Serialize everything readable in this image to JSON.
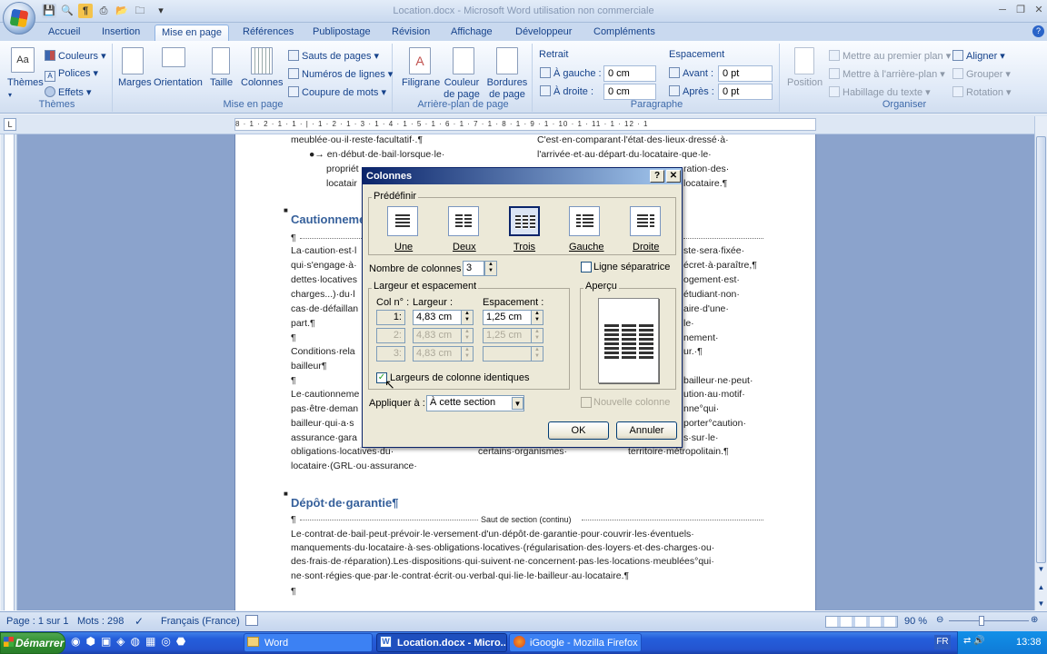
{
  "window": {
    "title": "Location.docx - Microsoft Word utilisation non commerciale"
  },
  "tabs": [
    "Accueil",
    "Insertion",
    "Mise en page",
    "Références",
    "Publipostage",
    "Révision",
    "Affichage",
    "Développeur",
    "Compléments"
  ],
  "active_tab": "Mise en page",
  "ribbon": {
    "themes": {
      "themes_label": "Thèmes",
      "colors": "Couleurs",
      "fonts": "Polices",
      "effects": "Effets",
      "group_label": "Thèmes"
    },
    "page_setup": {
      "margins": "Marges",
      "orientation": "Orientation",
      "size": "Taille",
      "columns": "Colonnes",
      "breaks": "Sauts de pages",
      "line_numbers": "Numéros de lignes",
      "hyphenation": "Coupure de mots",
      "group_label": "Mise en page"
    },
    "page_bg": {
      "watermark": "Filigrane",
      "page_color": "Couleur de page",
      "page_borders": "Bordures de page",
      "group_label": "Arrière-plan de page"
    },
    "paragraph": {
      "indent_label": "Retrait",
      "left_label": "À gauche :",
      "left_value": "0 cm",
      "right_label": "À droite :",
      "right_value": "0 cm",
      "spacing_label": "Espacement",
      "before_label": "Avant :",
      "before_value": "0 pt",
      "after_label": "Après :",
      "after_value": "0 pt",
      "group_label": "Paragraphe"
    },
    "arrange": {
      "position": "Position",
      "bring_front": "Mettre au premier plan",
      "send_back": "Mettre à l'arrière-plan",
      "wrap": "Habillage du texte",
      "align": "Aligner",
      "group": "Grouper",
      "rotate": "Rotation",
      "group_label": "Organiser"
    }
  },
  "ruler": {
    "text": "8 · 1 · 2 · 1 · 1 · | · 1 · 2 · 1 · 3 · 1 · 4 · 1 · 5 · 1 · 6 · 1 · 7 · 1 · 8 · 1 · 9 · 1 · 10 · 1 · 11 · 1 · 12 · 1"
  },
  "document": {
    "lines": [
      "meublée·ou·il·reste·facultatif·.¶",
      "●→ en·début·de·bail·lorsque·le·",
      "propriét",
      "locatair",
      "C'est·en·comparant·l'état·des·lieux·dressé·à·",
      "l'arrivée·et·au·départ·du·locataire·que·le·",
      "ration·des·",
      "locataire.¶",
      "La·caution·est·l",
      "qui·s'engage·à·",
      "dettes·locatives",
      "charges...)·du·l",
      "cas·de·défaillan",
      "part.¶",
      "¶",
      "Conditions·rela",
      "bailleur¶",
      "¶",
      "Le·cautionneme",
      "pas·être·deman",
      "bailleur·qui·a·s",
      "assurance·gara",
      "obligations·locatives·du·",
      "locataire·(GRL·ou·assurance·",
      "certains·organismes·",
      "territoire·métropolitain.¶",
      "Le·contrat·de·bail·peut·prévoir·le·versement·d'un·dépôt·de·garantie·pour·couvrir·les·éventuels·",
      "manquements·du·locataire·à·ses·obligations·locatives·(régularisation·des·loyers·et·des·charges·ou·",
      "des·frais·de·réparation).Les·dispositions·qui·suivent·ne·concernent·pas·les·locations·meublées°qui·",
      "ne·sont·régies·que·par·le·contrat·écrit·ou·verbal·qui·lie·le·bailleur·au·locataire.¶",
      "¶",
      "¶"
    ],
    "right_fragments": [
      "ste·sera·fixée·",
      "écret·à·paraître,¶",
      "ogement·est·",
      "étudiant·non·",
      "aire·d'une·",
      "le·",
      "nement·",
      "ur.·¶",
      "bailleur·ne·peut·",
      "ution·au·motif·",
      "nne°qui·",
      "porter°caution·",
      "s·sur·le·"
    ],
    "heading_caution": "Cautionnement",
    "heading_depot": "Dépôt·de·garantie¶",
    "section_break": "Saut de section (continu)"
  },
  "dialog": {
    "title": "Colonnes",
    "help": "?",
    "close": "✕",
    "presets_label": "Prédéfinir",
    "presets": [
      "Une",
      "Deux",
      "Trois",
      "Gauche",
      "Droite"
    ],
    "selected_preset": "Trois",
    "num_cols_label": "Nombre de colonnes :",
    "num_cols_value": "3",
    "line_between_label": "Ligne séparatrice",
    "width_spacing_label": "Largeur et espacement",
    "col_no_label": "Col n° :",
    "width_label": "Largeur :",
    "spacing_label": "Espacement :",
    "rows": [
      {
        "n": "1:",
        "width": "4,83 cm",
        "spacing": "1,25 cm"
      },
      {
        "n": "2:",
        "width": "4,83 cm",
        "spacing": "1,25 cm"
      },
      {
        "n": "3:",
        "width": "4,83 cm",
        "spacing": ""
      }
    ],
    "equal_width_label": "Largeurs de colonne identiques",
    "equal_width_checked": true,
    "preview_label": "Aperçu",
    "apply_label": "Appliquer à :",
    "apply_value": "À cette section",
    "new_column_label": "Nouvelle colonne",
    "ok": "OK",
    "cancel": "Annuler"
  },
  "status": {
    "page": "Page : 1 sur 1",
    "words": "Mots : 298",
    "language": "Français (France)",
    "zoom": "90 %"
  },
  "taskbar": {
    "start": "Démarrer",
    "tasks": [
      "Word",
      "Location.docx - Micro...",
      "iGoogle - Mozilla Firefox"
    ],
    "lang": "FR",
    "time": "13:38"
  }
}
